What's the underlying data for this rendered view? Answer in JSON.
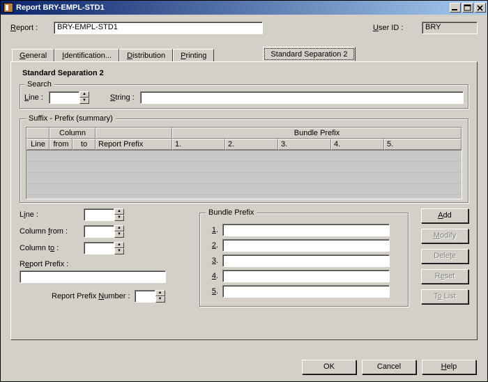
{
  "window": {
    "title": "Report BRY-EMPL-STD1"
  },
  "header": {
    "report_label": "Report :",
    "report_value": "BRY-EMPL-STD1",
    "userid_label": "User ID :",
    "userid_value": "BRY"
  },
  "tabs": {
    "general": "General",
    "identification": "Identification...",
    "distribution": "Distribution",
    "printing": "Printing",
    "standard_sep2": "Standard Separation 2"
  },
  "panel": {
    "title": "Standard Separation 2",
    "search_legend": "Search",
    "line_label": "Line :",
    "string_label": "String :",
    "line_value": "",
    "string_value": "",
    "suffix_legend": "Suffix - Prefix (summary)",
    "grid": {
      "group_column": "Column",
      "group_bundle": "Bundle Prefix",
      "h_line": "Line",
      "h_from": "from",
      "h_to": "to",
      "h_reportprefix": "Report Prefix",
      "h1": "1.",
      "h2": "2.",
      "h3": "3.",
      "h4": "4.",
      "h5": "5."
    },
    "form": {
      "line_label": "Line :",
      "colfrom_label": "Column from :",
      "colto_label": "Column to :",
      "reportprefix_label": "Report Prefix :",
      "reportprefix_num_label": "Report Prefix Number :",
      "line_value": "",
      "colfrom_value": "",
      "colto_value": "",
      "reportprefix_value": "",
      "reportprefix_num_value": ""
    },
    "bundle_legend": "Bundle Prefix",
    "bundle": {
      "l1": "1.",
      "l2": "2.",
      "l3": "3.",
      "l4": "4.",
      "l5": "5.",
      "v1": "",
      "v2": "",
      "v3": "",
      "v4": "",
      "v5": ""
    },
    "buttons": {
      "add": "Add",
      "modify": "Modify",
      "delete": "Delete",
      "reset": "Reset",
      "tolist": "To List"
    }
  },
  "footer": {
    "ok": "OK",
    "cancel": "Cancel",
    "help": "Help"
  }
}
